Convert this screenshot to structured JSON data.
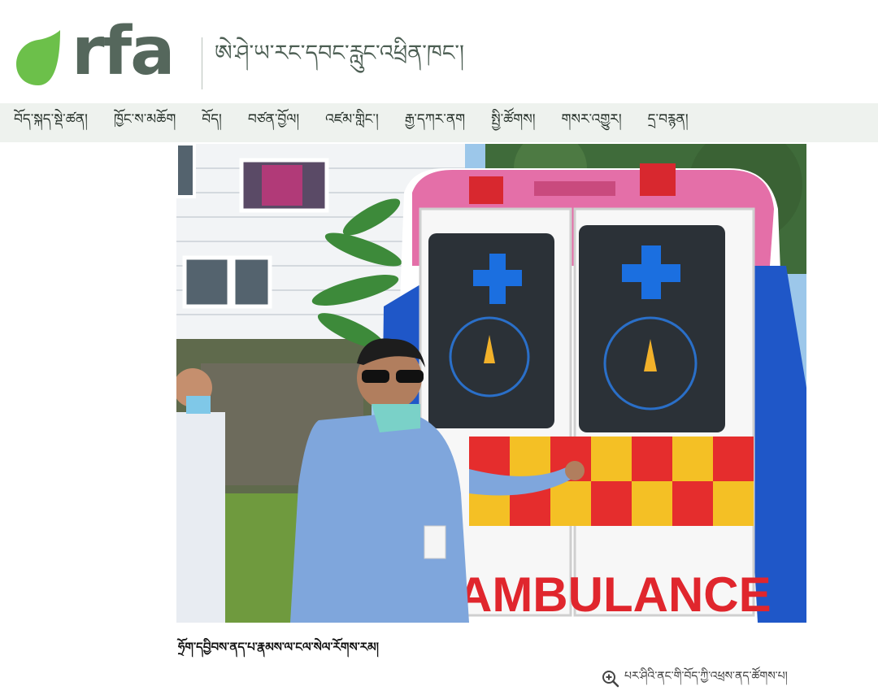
{
  "header": {
    "logo_text": "rfa",
    "service_title": "ཨེ་ཤེ་ཡ་རང་དབང་རླུང་འཕྲིན་ཁང་།",
    "brand_colors": {
      "logo_dot": "#6cc04a",
      "logo_text": "#55675c",
      "nav_bg": "#eef2ee"
    }
  },
  "nav": {
    "items": [
      {
        "label": "བོད་སྐད་སྡེ་ཚན།"
      },
      {
        "label": "ཁྱོང་ས་མཆོག"
      },
      {
        "label": "བོད།"
      },
      {
        "label": "བཙན་བྱོལ།"
      },
      {
        "label": "འཛམ་གླིང་།"
      },
      {
        "label": "རྒྱ་དཀར་ནག"
      },
      {
        "label": "སྤྱི་ཚོགས།"
      },
      {
        "label": "གསར་འགྱུར།"
      },
      {
        "label": "དྲ་བརྙན།"
      }
    ]
  },
  "article": {
    "photo_description_icon": "ambulance-photo",
    "ambulance_text": "AMBULANCE",
    "caption": "ཧྲོག་དབྱིབས་ནད་པ་རྣམས་ལ་ངལ་སེལ་རོགས་རམ།",
    "zoom_label": "པར་ཤིའི་ནང་གི་བོད་ཀྱི་འཕྲས་ནད་ཚོགས་པ།",
    "zoom_icon": "zoom-in-icon"
  }
}
